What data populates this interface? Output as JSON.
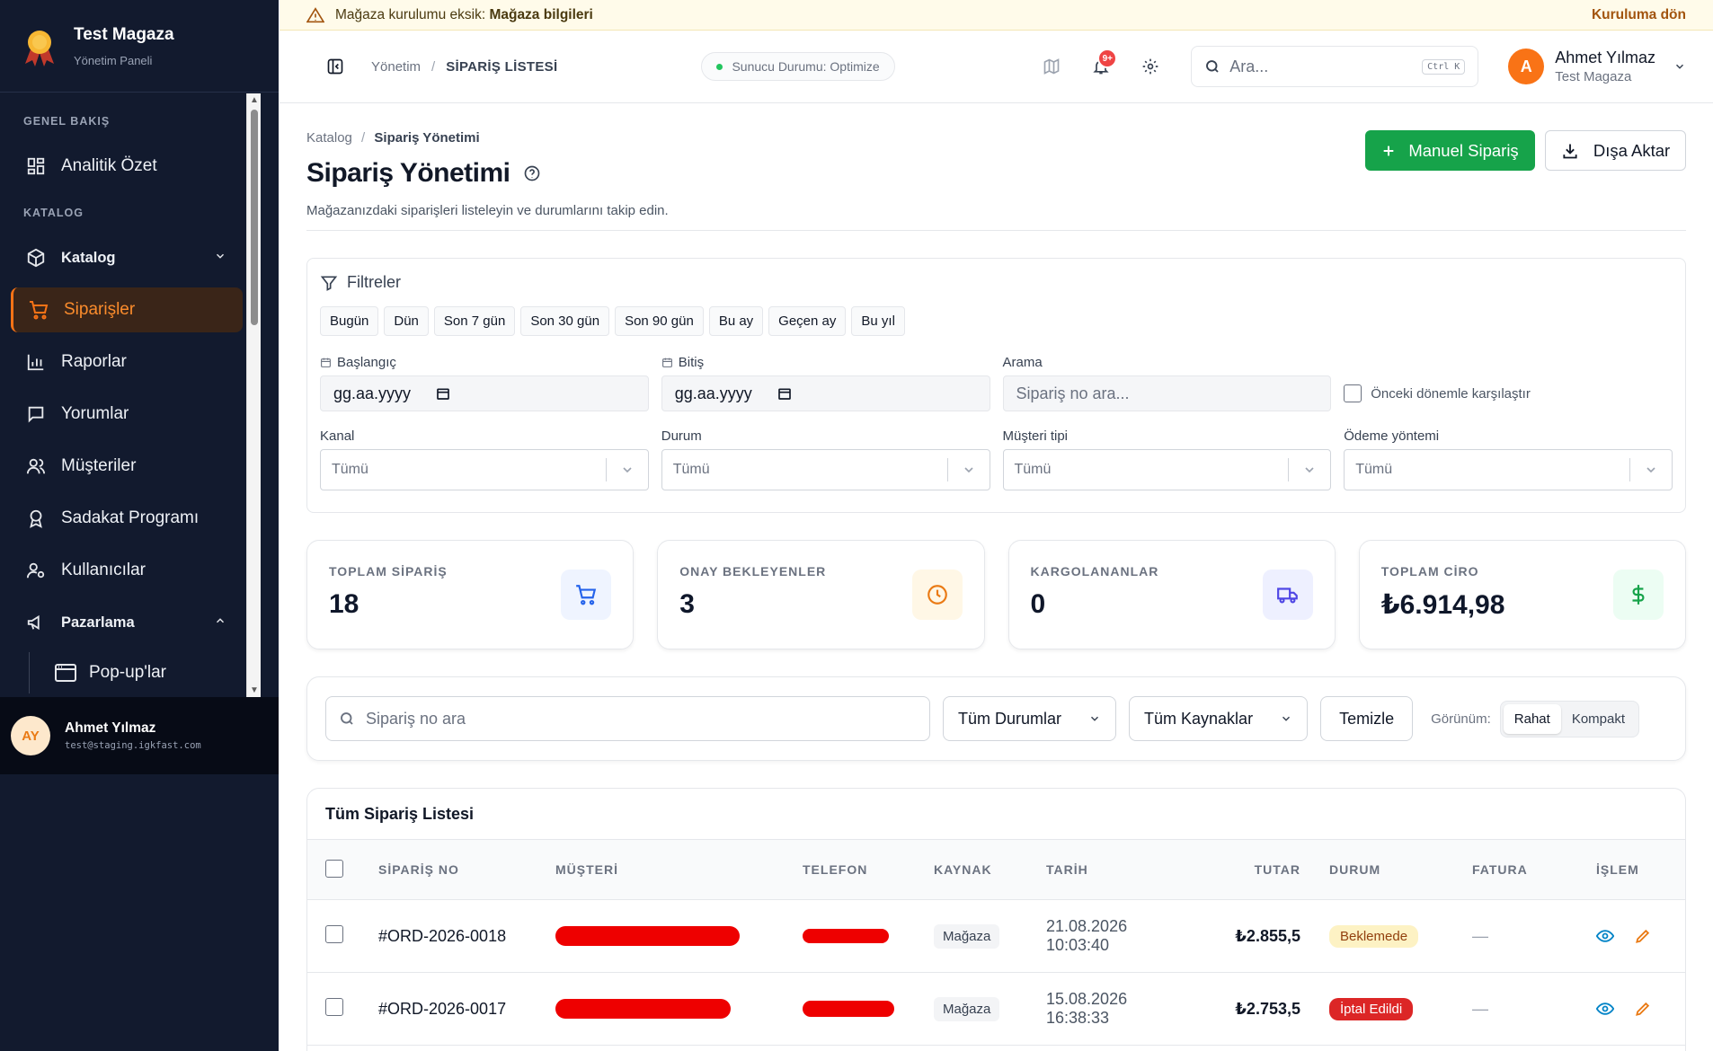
{
  "brand": {
    "title": "Test Magaza",
    "subtitle": "Yönetim Paneli"
  },
  "sidebar": {
    "sections": [
      "GENEL BAKIŞ",
      "KATALOG"
    ],
    "items": [
      {
        "label": "Analitik Özet",
        "icon": "dashboard-icon"
      },
      {
        "label": "Katalog",
        "icon": "box-icon"
      },
      {
        "label": "Siparişler",
        "icon": "cart-icon",
        "active": true
      },
      {
        "label": "Raporlar",
        "icon": "bar-chart-icon"
      },
      {
        "label": "Yorumlar",
        "icon": "comment-icon"
      },
      {
        "label": "Müşteriler",
        "icon": "users-icon"
      },
      {
        "label": "Sadakat Programı",
        "icon": "award-icon"
      },
      {
        "label": "Kullanıcılar",
        "icon": "user-gear-icon"
      },
      {
        "label": "Pazarlama",
        "icon": "megaphone-icon"
      }
    ],
    "sub_items": [
      {
        "label": "Pop-up'lar",
        "icon": "window-icon"
      }
    ],
    "user": {
      "initials": "AY",
      "name": "Ahmet Yılmaz",
      "email": "test@staging.igkfast.com"
    }
  },
  "banner": {
    "prefix": "Mağaza kurulumu eksik:",
    "bold": "Mağaza bilgileri",
    "action": "Kuruluma dön"
  },
  "topbar": {
    "crumb_root": "Yönetim",
    "crumb_current": "SİPARİŞ LİSTESİ",
    "server_status": "Sunucu Durumu: Optimize",
    "notif_count": "9+",
    "search_placeholder": "Ara...",
    "search_kbd": "Ctrl K",
    "user_initial": "A",
    "user_name": "Ahmet Yılmaz",
    "user_shop": "Test Magaza"
  },
  "page": {
    "crumb_root": "Katalog",
    "crumb_current": "Sipariş Yönetimi",
    "title": "Sipariş Yönetimi",
    "subtitle": "Mağazanızdaki siparişleri listeleyin ve durumlarını takip edin.",
    "primary_button": "Manuel Sipariş",
    "export_button": "Dışa Aktar"
  },
  "filters": {
    "title": "Filtreler",
    "quick_ranges": [
      "Bugün",
      "Dün",
      "Son 7 gün",
      "Son 30 gün",
      "Son 90 gün",
      "Bu ay",
      "Geçen ay",
      "Bu yıl"
    ],
    "start_label": "Başlangıç",
    "start_value": "gg.aa.yyyy",
    "end_label": "Bitiş",
    "end_value": "gg.aa.yyyy",
    "search_label": "Arama",
    "search_placeholder": "Sipariş no ara...",
    "compare_label": "Önceki dönemle karşılaştır",
    "channel_label": "Kanal",
    "channel_value": "Tümü",
    "status_label": "Durum",
    "status_value": "Tümü",
    "customer_type_label": "Müşteri tipi",
    "customer_type_value": "Tümü",
    "payment_label": "Ödeme yöntemi",
    "payment_value": "Tümü"
  },
  "stats": [
    {
      "label": "TOPLAM SİPARİŞ",
      "value": "18",
      "icon": "cart-icon",
      "color": "#2563eb",
      "bg": "#eff4ff"
    },
    {
      "label": "ONAY BEKLEYENLER",
      "value": "3",
      "icon": "clock-icon",
      "color": "#ea7a14",
      "bg": "#fff7e6"
    },
    {
      "label": "KARGOLANANLAR",
      "value": "0",
      "icon": "truck-icon",
      "color": "#4f46e5",
      "bg": "#eef0ff"
    },
    {
      "label": "TOPLAM CİRO",
      "value": "₺6.914,98",
      "icon": "dollar-icon",
      "color": "#16a34a",
      "bg": "#ecfdf3"
    }
  ],
  "toolbar": {
    "search_placeholder": "Sipariş no ara",
    "status_filter": "Tüm Durumlar",
    "source_filter": "Tüm Kaynaklar",
    "clear_button": "Temizle",
    "view_label": "Görünüm:",
    "view_options": [
      "Rahat",
      "Kompakt"
    ]
  },
  "orders": {
    "title": "Tüm Sipariş Listesi",
    "columns": [
      "SİPARİŞ NO",
      "MÜŞTERİ",
      "TELEFON",
      "KAYNAK",
      "TARİH",
      "TUTAR",
      "DURUM",
      "FATURA",
      "İŞLEM"
    ],
    "rows": [
      {
        "id": "#ORD-2026-0018",
        "source": "Mağaza",
        "date": "21.08.2026 10:03:40",
        "total": "₺2.855,5",
        "status": "Beklemede",
        "invoice": "—"
      },
      {
        "id": "#ORD-2026-0017",
        "source": "Mağaza",
        "date": "15.08.2026 16:38:33",
        "total": "₺2.753,5",
        "status": "İptal Edildi",
        "invoice": "—"
      }
    ]
  },
  "colors": {
    "accent": "#f97316",
    "primary": "#16a34a",
    "sidebar_bg": "#121a2e",
    "danger": "#dc2626"
  }
}
